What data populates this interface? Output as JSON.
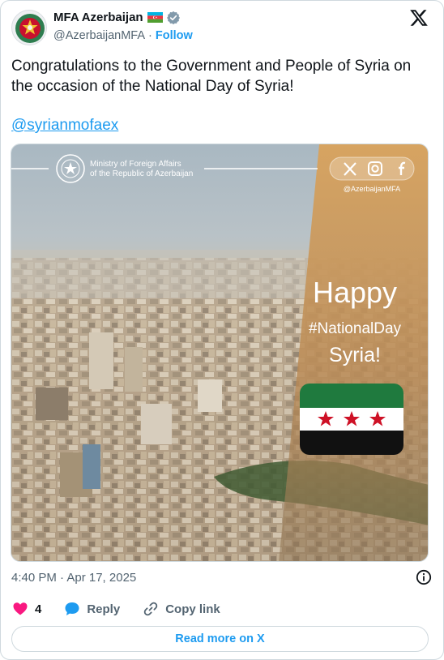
{
  "author": {
    "name": "MFA Azerbaijan",
    "handle": "@AzerbaijanMFA",
    "separator": "·",
    "follow_label": "Follow"
  },
  "tweet": {
    "text": "Congratulations to the Government and People of Syria on the occasion of the National Day of Syria!",
    "mention": "@syrianmofaex",
    "timestamp": "4:40 PM · Apr 17, 2025"
  },
  "media": {
    "ministry_line1": "Ministry of Foreign Affairs",
    "ministry_line2": "of the Republic of Azerbaijan",
    "social_handle": "@AzerbaijanMFA",
    "happy": "Happy",
    "hashtag": "#NationalDay",
    "country": "Syria!",
    "panel_color": "#c9a064",
    "flag_colors": {
      "green": "#1f7a3e",
      "white": "#ffffff",
      "black": "#111111",
      "star": "#ce1126"
    }
  },
  "actions": {
    "like_count": "4",
    "reply_label": "Reply",
    "copy_link_label": "Copy link"
  },
  "footer": {
    "read_more_label": "Read more on X"
  },
  "colors": {
    "accent": "#1d9bf0",
    "like": "#f91880",
    "muted": "#536471"
  }
}
